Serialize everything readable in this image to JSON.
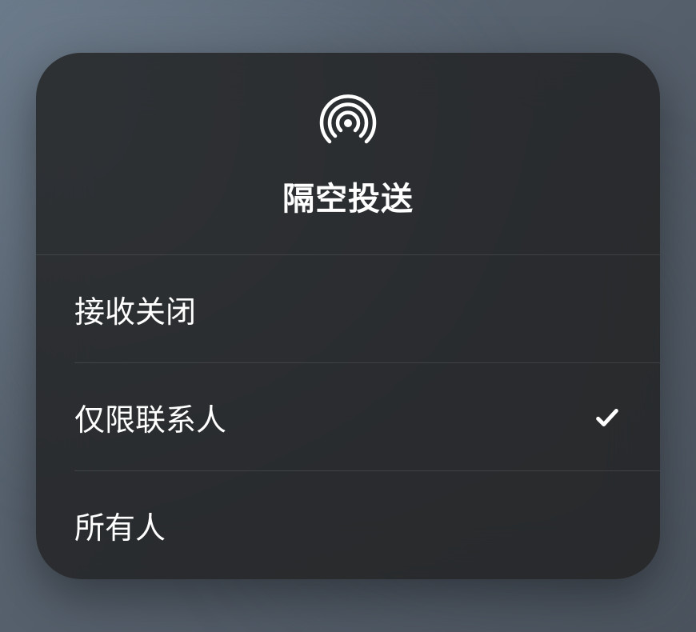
{
  "panel": {
    "title": "隔空投送",
    "icon_name": "airdrop-icon"
  },
  "options": [
    {
      "label": "接收关闭",
      "selected": false
    },
    {
      "label": "仅限联系人",
      "selected": true
    },
    {
      "label": "所有人",
      "selected": false
    }
  ]
}
